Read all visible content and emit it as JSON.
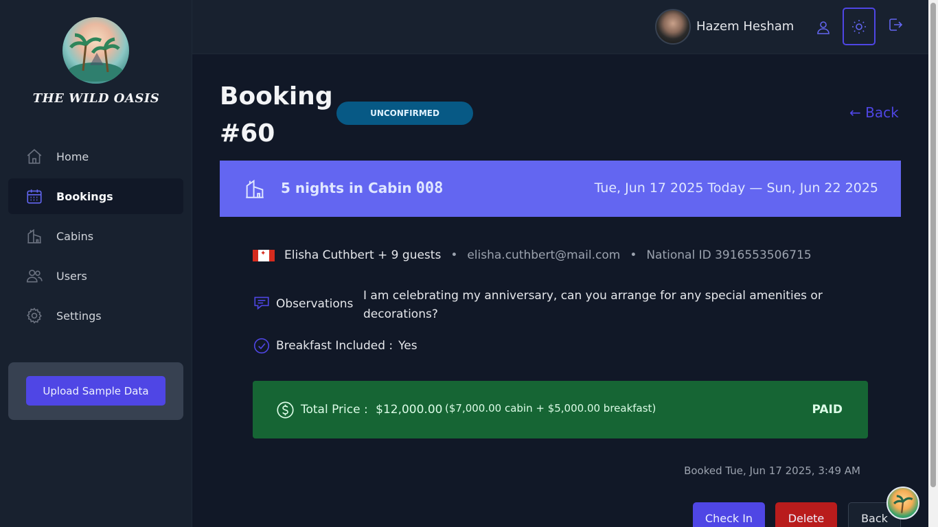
{
  "app": {
    "logo_text": "THE WILD OASIS"
  },
  "sidebar": {
    "items": [
      {
        "label": "Home",
        "icon": "home-icon",
        "active": false
      },
      {
        "label": "Bookings",
        "icon": "calendar-icon",
        "active": true
      },
      {
        "label": "Cabins",
        "icon": "cabin-icon",
        "active": false
      },
      {
        "label": "Users",
        "icon": "users-icon",
        "active": false
      },
      {
        "label": "Settings",
        "icon": "gear-icon",
        "active": false
      }
    ],
    "upload_label": "Upload Sample Data"
  },
  "header": {
    "user_name": "Hazem Hesham"
  },
  "booking": {
    "title": "Booking #60",
    "status": "UNCONFIRMED",
    "back_link": "← Back",
    "nights_text": "5 nights in Cabin",
    "cabin_number": "008",
    "dates": "Tue, Jun 17 2025 Today — Sun, Jun 22 2025",
    "guest_name": "Elisha Cuthbert + 9 guests",
    "guest_email": "elisha.cuthbert@mail.com",
    "national_id": "National ID 3916553506715",
    "observations_label": "Observations",
    "observations_text": "I am celebrating my anniversary, can you arrange for any special amenities or decorations?",
    "breakfast_label": "Breakfast Included :",
    "breakfast_value": "Yes",
    "total_label": "Total Price :",
    "total_value": "$12,000.00",
    "price_breakdown": "($7,000.00 cabin  +  $5,000.00 breakfast)",
    "paid_label": "PAID",
    "booked_at": "Booked Tue, Jun 17 2025, 3:49 AM"
  },
  "actions": {
    "check_in": "Check In",
    "delete": "Delete",
    "back": "Back"
  },
  "colors": {
    "accent": "#4f46e5",
    "banner": "#6366f1",
    "status_unconfirmed": "#075985",
    "paid_green": "#166534",
    "danger": "#b91c1c"
  }
}
